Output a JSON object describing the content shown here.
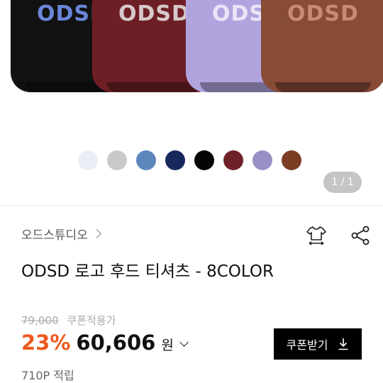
{
  "gallery": {
    "hoodies": [
      {
        "color": "#111111",
        "logo": "ODSD",
        "logo_color": "#6a86d9"
      },
      {
        "color": "#6e1f26",
        "logo": "ODSD",
        "logo_color": "#d7c9cb"
      },
      {
        "color": "#b1a4de",
        "logo": "ODSD",
        "logo_color": "#e9e4f7"
      },
      {
        "color": "#874b36",
        "logo": "ODSD",
        "logo_color": "#c98a70"
      }
    ],
    "swatches": [
      "#eceef6",
      "#c9c9c9",
      "#5d86bd",
      "#17285d",
      "#050505",
      "#6f2128",
      "#9b8fc7",
      "#7b3d24"
    ],
    "pager": "1 / 1"
  },
  "brand": {
    "name": "오드스튜디오"
  },
  "product": {
    "title": "ODSD 로고 후드 티셔츠 - 8COLOR"
  },
  "pricing": {
    "original": "79,000",
    "coupon_label": "쿠폰적용가",
    "discount": "23%",
    "price": "60,606",
    "currency": "원"
  },
  "coupon_button": {
    "label": "쿠폰받기"
  },
  "points": {
    "text": "710P 적립"
  },
  "icons": {
    "fit": "shirt-size-icon",
    "share": "share-icon",
    "download": "download-icon"
  }
}
